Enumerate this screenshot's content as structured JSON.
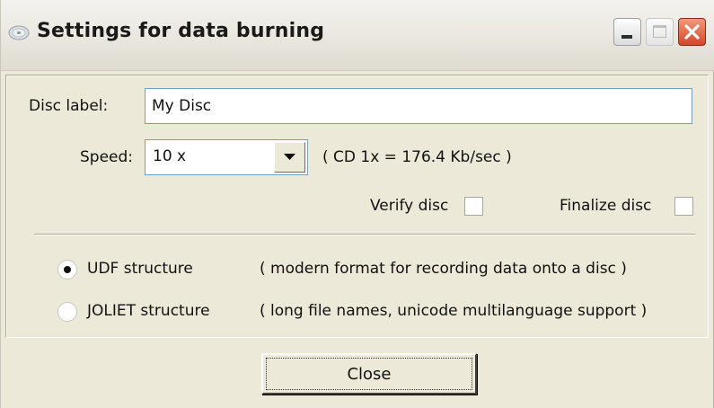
{
  "window": {
    "title": "Settings for data burning",
    "icon": "disc-icon",
    "controls": [
      "minimize",
      "maximize",
      "close"
    ]
  },
  "form": {
    "disc_label": {
      "label": "Disc label:",
      "value": "My Disc"
    },
    "speed": {
      "label": "Speed:",
      "selected": "10 x",
      "note": "( CD 1x = 176.4 Kb/sec )"
    },
    "verify_disc": {
      "label": "Verify disc",
      "checked": false
    },
    "finalize_disc": {
      "label": "Finalize disc",
      "checked": false
    },
    "structures": [
      {
        "label": "UDF structure",
        "description": "( modern format for recording data onto a disc )",
        "selected": true
      },
      {
        "label": "JOLIET structure",
        "description": "( long file names, unicode multilanguage support )",
        "selected": false
      }
    ]
  },
  "buttons": {
    "close_label": "Close"
  },
  "colors": {
    "window_background": "#ece9d8",
    "close_button_red": "#d6452a",
    "input_border": "#7f9db9"
  }
}
